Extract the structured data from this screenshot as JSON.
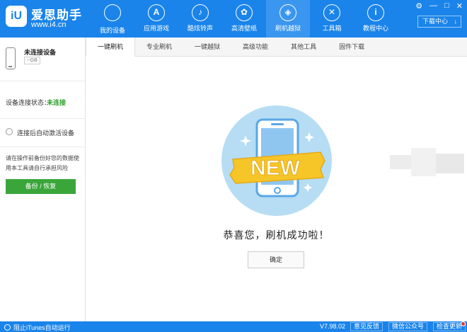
{
  "app": {
    "brand_title": "爱思助手",
    "brand_url": "www.i4.cn",
    "logo_text": "iU"
  },
  "nav": {
    "items": [
      {
        "label": "我的设备",
        "icon": "apple-icon",
        "glyph": ""
      },
      {
        "label": "应用游戏",
        "icon": "app-store-icon",
        "glyph": "A"
      },
      {
        "label": "酷炫铃声",
        "icon": "bell-icon",
        "glyph": "♪"
      },
      {
        "label": "高清壁纸",
        "icon": "flower-icon",
        "glyph": "✿"
      },
      {
        "label": "刷机越狱",
        "icon": "dropbox-icon",
        "glyph": "◈"
      },
      {
        "label": "工具箱",
        "icon": "tools-icon",
        "glyph": "✕"
      },
      {
        "label": "教程中心",
        "icon": "info-icon",
        "glyph": "i"
      }
    ],
    "active_index": 4
  },
  "window": {
    "controls": [
      "⚙",
      "—",
      "□",
      "✕"
    ],
    "download_center": "下载中心",
    "download_arrow": "↓"
  },
  "sidebar": {
    "device_name": "未连接设备",
    "device_capacity": "--GB",
    "connection_label": "设备连接状态：",
    "connection_value": "未连接",
    "auto_activate_label": "连接后自动激活设备",
    "tip": "请在操作前备份好您的数据使用本工具请自行承担风险",
    "backup_button": "备份 / 恢复"
  },
  "tabs": [
    "一键刷机",
    "专业刷机",
    "一键越狱",
    "高级功能",
    "其他工具",
    "固件下载"
  ],
  "main": {
    "badge_text": "NEW",
    "success_message": "恭喜您，刷机成功啦！",
    "ok_button": "确定"
  },
  "footer": {
    "itunes_toggle": "阻止iTunes自动运行",
    "version": "V7.98.02",
    "feedback": "意见反馈",
    "wechat": "微信公众号",
    "check_update": "检查更新"
  },
  "colors": {
    "brand_blue": "#1a84ea",
    "success_green": "#3aa63a",
    "ribbon_yellow": "#f6c628",
    "illus_bg": "#b6ddf4"
  }
}
